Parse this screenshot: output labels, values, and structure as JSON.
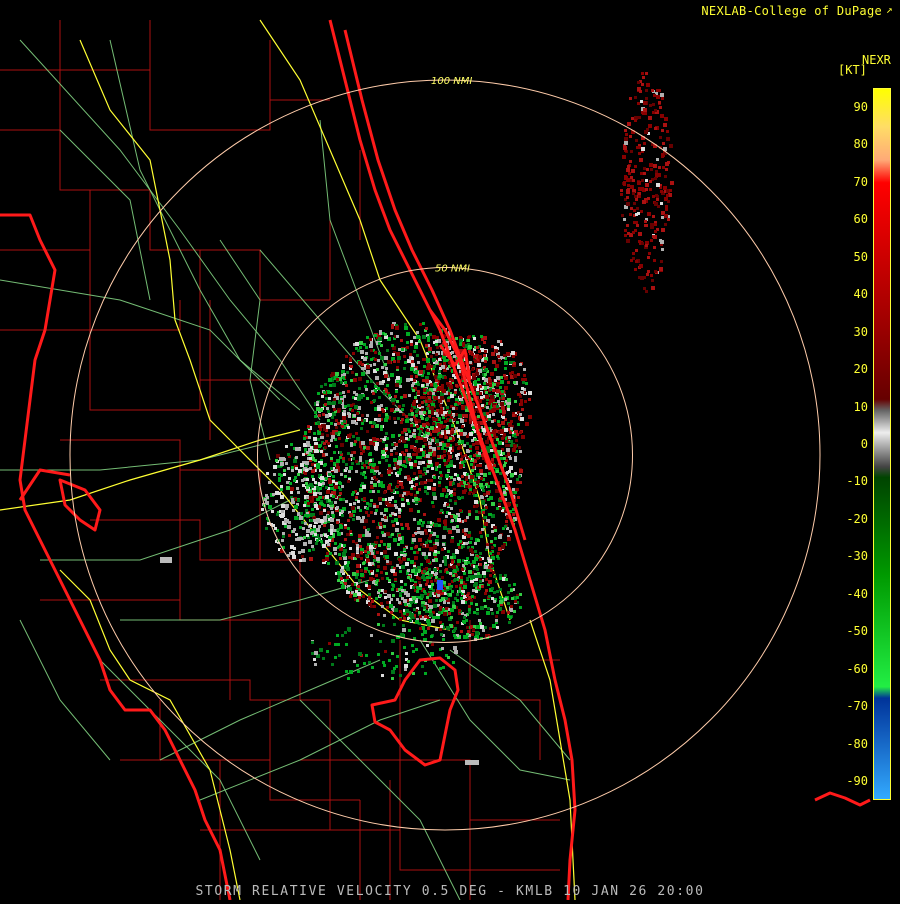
{
  "credit": "NEXLAB-College of DuPage",
  "legend": {
    "product": "NEXR",
    "unit": "[KT]",
    "ticks": [
      "90",
      "80",
      "70",
      "60",
      "50",
      "40",
      "30",
      "20",
      "10",
      "0",
      "-10",
      "-20",
      "-30",
      "-40",
      "-50",
      "-60",
      "-70",
      "-80",
      "-90"
    ],
    "range": [
      -95,
      95
    ],
    "stops": [
      {
        "v": 95,
        "color": "#ffff00"
      },
      {
        "v": 85,
        "color": "#ffdd66"
      },
      {
        "v": 76,
        "color": "#ffaa77"
      },
      {
        "v": 70,
        "color": "#ff0000"
      },
      {
        "v": 50,
        "color": "#cc0000"
      },
      {
        "v": 30,
        "color": "#990000"
      },
      {
        "v": 12,
        "color": "#660000"
      },
      {
        "v": 9,
        "color": "#666666"
      },
      {
        "v": 3,
        "color": "#eeeeee"
      },
      {
        "v": -6,
        "color": "#444444"
      },
      {
        "v": -9,
        "color": "#004400"
      },
      {
        "v": -35,
        "color": "#009900"
      },
      {
        "v": -65,
        "color": "#22ee44"
      },
      {
        "v": -68,
        "color": "#003399"
      },
      {
        "v": -95,
        "color": "#33aaff"
      }
    ]
  },
  "range_rings": [
    {
      "label": "100 NMI",
      "nmi": 100
    },
    {
      "label": "50 NMI",
      "nmi": 50
    }
  ],
  "caption": "STORM RELATIVE VELOCITY 0.5 DEG - KMLB 10 JAN 26 20:00",
  "colors": {
    "coast": "#ff1a1a",
    "county": "#aa1111",
    "roads_major": "#ffff33",
    "roads_minor": "#88dd88",
    "rings": "#ffccaa"
  }
}
